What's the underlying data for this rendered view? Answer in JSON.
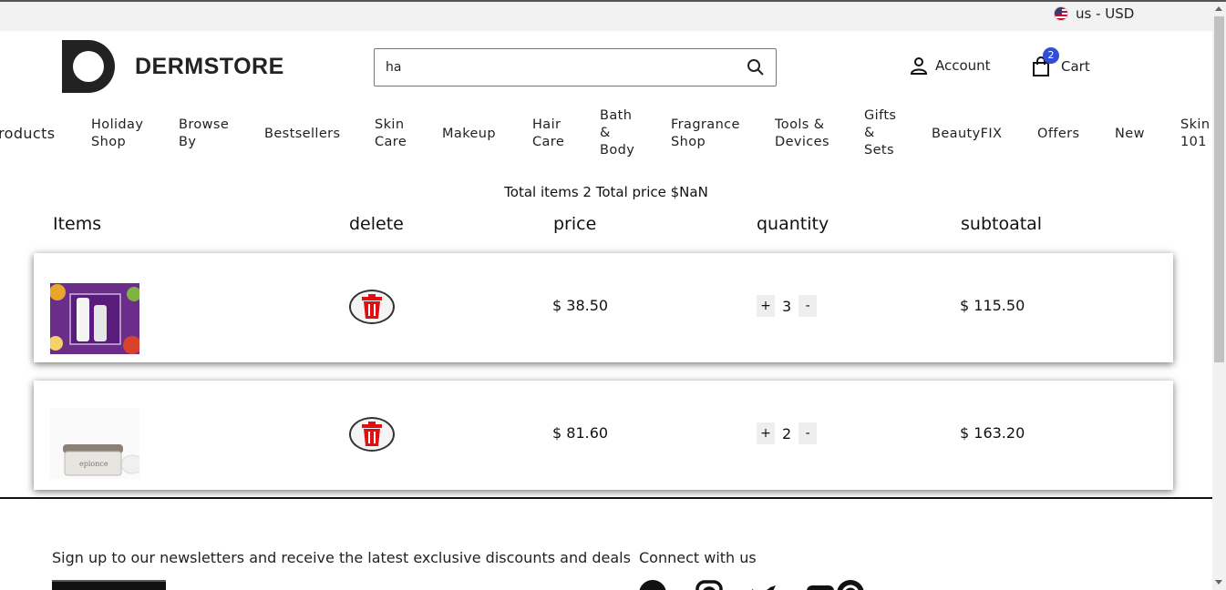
{
  "locale": {
    "label": "us - USD",
    "flag_icon": "us-flag-icon"
  },
  "brand": {
    "name": "DERMSTORE"
  },
  "search": {
    "value": "ha",
    "icon": "search-icon"
  },
  "header": {
    "account_label": "Account",
    "cart_label": "Cart",
    "cart_count": "2"
  },
  "nav": [
    "roducts",
    "Holiday\nShop",
    "Browse\nBy",
    "Bestsellers",
    "Skin\nCare",
    "Makeup",
    "Hair\nCare",
    "Bath\n&\nBody",
    "Fragrance\nShop",
    "Tools &\nDevices",
    "Gifts\n&\nSets",
    "BeautyFIX",
    "Offers",
    "New",
    "Skin\n101"
  ],
  "cart_summary": "Total items 2 Total price $NaN",
  "columns": {
    "items": "Items",
    "delete": "delete",
    "price": "price",
    "quantity": "quantity",
    "subtotal": "subtoatal"
  },
  "cart_items": [
    {
      "price": "$ 38.50",
      "qty": "3",
      "subtotal": "$ 115.50",
      "qty_plus": "+",
      "qty_minus": "-"
    },
    {
      "price": "$ 81.60",
      "qty": "2",
      "subtotal": "$ 163.20",
      "qty_plus": "+",
      "qty_minus": "-"
    }
  ],
  "footer": {
    "newsletter_text": "Sign up to our newsletters and receive the latest exclusive discounts and deals",
    "connect_text": "Connect with us",
    "social_icons": [
      "facebook-icon",
      "instagram-icon",
      "twitter-icon",
      "youtube-icon",
      "pinterest-icon"
    ]
  },
  "colors": {
    "badge": "#2f4fd8",
    "trash": "#e01010",
    "topbar": "#f2f2f2"
  }
}
